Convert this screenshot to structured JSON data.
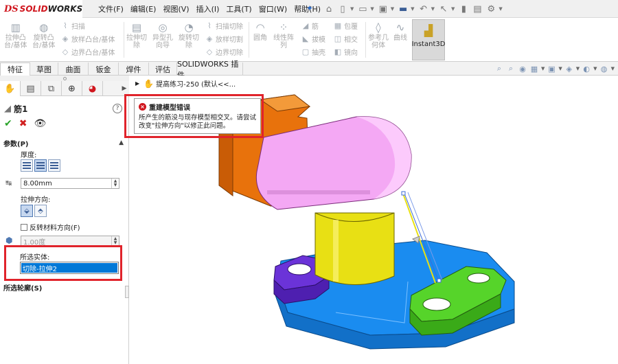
{
  "app": {
    "logo_ds": "DS",
    "logo_brand_red": "SOLID",
    "logo_brand_dark": "WORKS"
  },
  "menu": [
    "文件(F)",
    "编辑(E)",
    "视图(V)",
    "插入(I)",
    "工具(T)",
    "窗口(W)",
    "帮助(H)"
  ],
  "ribbon": {
    "extrude_boss": "拉伸凸\n台/基体",
    "revolve_boss": "旋转凸\n台/基体",
    "sweep": "扫描",
    "loft_boss": "放样凸台/基体",
    "boundary_boss": "边界凸台/基体",
    "extrude_cut": "拉伸切\n除",
    "hole_wizard": "异型孔\n向导",
    "revolve_cut": "旋转切\n除",
    "sweep_cut": "扫描切除",
    "loft_cut": "放样切割",
    "boundary_cut": "边界切除",
    "fillet": "圆角",
    "linear_pattern": "线性阵\n列",
    "rib": "筋",
    "draft": "拔模",
    "shell": "抽壳",
    "wrap": "包覆",
    "intersect": "相交",
    "mirror": "镜向",
    "reference_geometry": "参考几\n何体",
    "curves": "曲线",
    "instant3d": "Instant3D"
  },
  "tabs": [
    "特征",
    "草图",
    "曲面",
    "钣金",
    "焊件",
    "评估",
    "SOLIDWORKS 插件"
  ],
  "active_tab": "特征",
  "panel": {
    "feature_name": "筋1",
    "params_header": "参数(P)",
    "thickness_label": "厚度:",
    "thickness_value": "8.00mm",
    "direction_label": "拉伸方向:",
    "flip_label": "反转材料方向(F)",
    "draft_value": "1.00度",
    "selected_bodies_label": "所选实体:",
    "selected_bodies": [
      "切除-拉伸2"
    ],
    "selected_contours_header": "所选轮廓(S)"
  },
  "viewport": {
    "breadcrumb": "提高练习-250  (默认<<..."
  },
  "error": {
    "title": "重建模型错误",
    "message": "所产生的筋没与现存模型相交叉。请尝试改变\"拉伸方向\"以修正此问题。"
  },
  "colors": {
    "accent": "#0078d7",
    "error": "#e0232b",
    "brand": "#d0161e"
  }
}
